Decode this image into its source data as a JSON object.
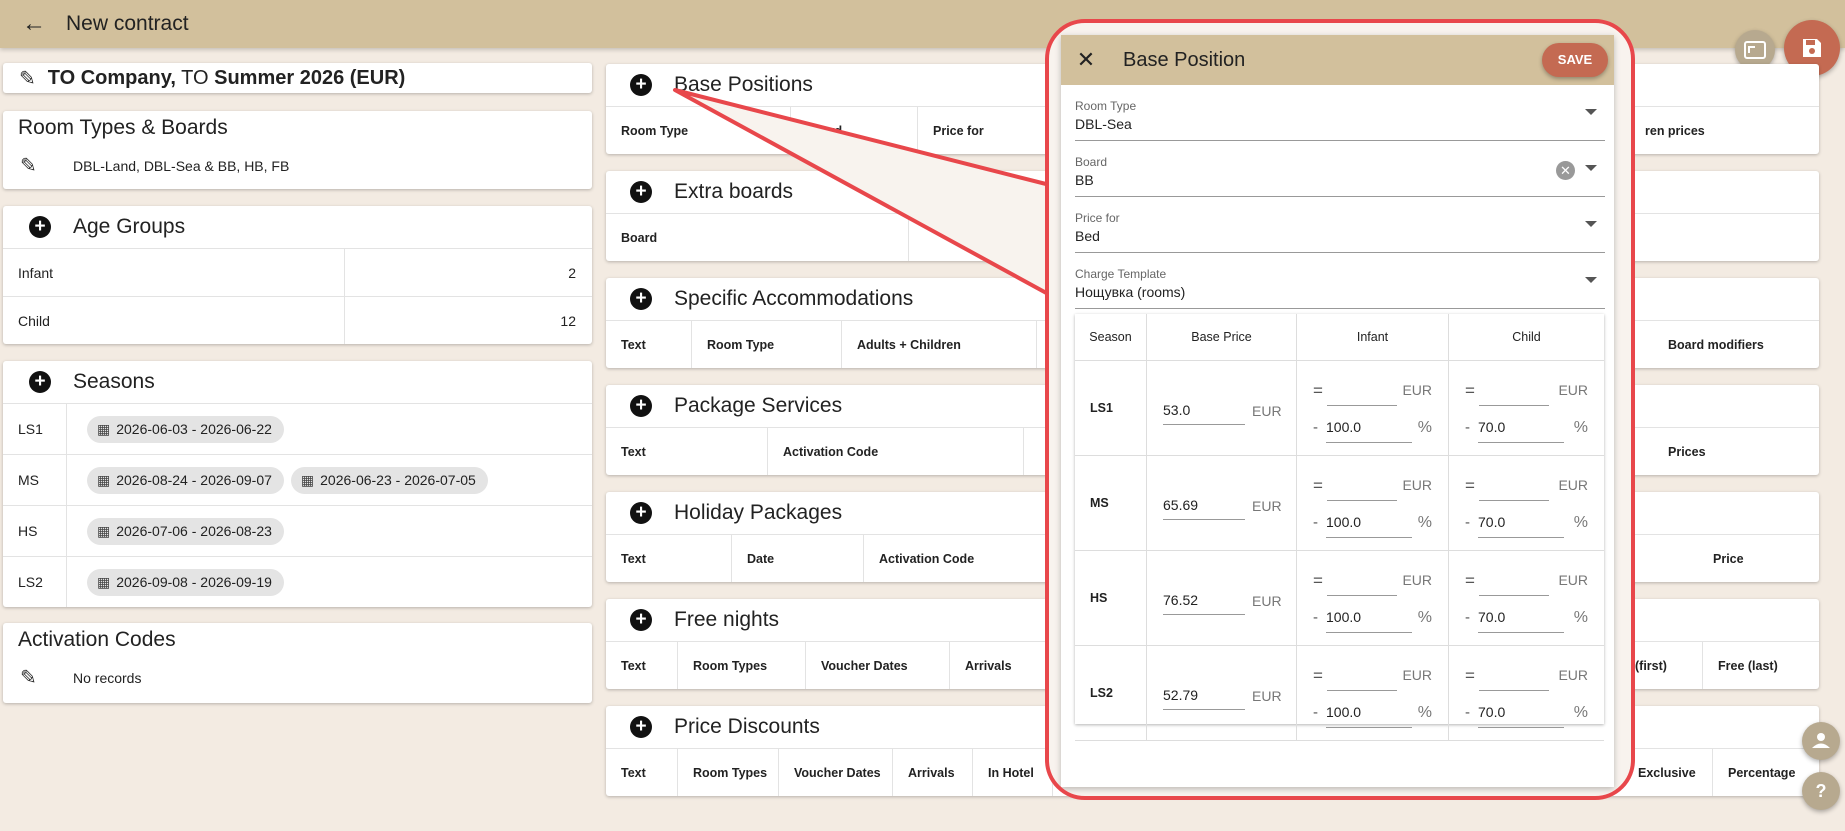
{
  "topbar": {
    "title": "New contract"
  },
  "contract": {
    "company": "TO Company,",
    "to": "TO",
    "season": "Summer 2026 (EUR)"
  },
  "room_types": {
    "title": "Room Types & Boards",
    "value": "DBL-Land, DBL-Sea & BB, HB, FB"
  },
  "age_groups": {
    "title": "Age Groups",
    "rows": [
      {
        "name": "Infant",
        "value": "2"
      },
      {
        "name": "Child",
        "value": "12"
      }
    ]
  },
  "seasons": {
    "title": "Seasons",
    "rows": [
      {
        "code": "LS1",
        "dates": [
          "2026-06-03 - 2026-06-22"
        ]
      },
      {
        "code": "MS",
        "dates": [
          "2026-08-24 - 2026-09-07",
          "2026-06-23 - 2026-07-05"
        ]
      },
      {
        "code": "HS",
        "dates": [
          "2026-07-06 - 2026-08-23"
        ]
      },
      {
        "code": "LS2",
        "dates": [
          "2026-09-08 - 2026-09-19"
        ]
      }
    ]
  },
  "activation_codes": {
    "title": "Activation Codes",
    "empty": "No records"
  },
  "right_cards": [
    {
      "title": "Base Positions",
      "cols": [
        "Room Type",
        "Board",
        "Price for"
      ],
      "right": [
        "ren prices"
      ]
    },
    {
      "title": "Extra boards",
      "cols": [
        "Board",
        ""
      ],
      "right": []
    },
    {
      "title": "Specific Accommodations",
      "cols": [
        "Text",
        "Room Type",
        "Adults + Children"
      ],
      "right": [
        "Board modifiers"
      ]
    },
    {
      "title": "Package Services",
      "cols": [
        "Text",
        "Activation Code"
      ],
      "right": [
        "Prices"
      ]
    },
    {
      "title": "Holiday Packages",
      "cols": [
        "Text",
        "Date",
        "Activation Code"
      ],
      "right": [
        "Price"
      ]
    },
    {
      "title": "Free nights",
      "cols": [
        "Text",
        "Room Types",
        "Voucher Dates",
        "Arrivals"
      ],
      "right": [
        "(first)",
        "Free (last)"
      ]
    },
    {
      "title": "Price Discounts",
      "cols": [
        "Text",
        "Room Types",
        "Voucher Dates",
        "Arrivals",
        "In Hotel"
      ],
      "right": [
        "Exclusive",
        "Percentage"
      ]
    }
  ],
  "dialog": {
    "title": "Base Position",
    "save_label": "SAVE",
    "fields": [
      {
        "label": "Room Type",
        "value": "DBL-Sea"
      },
      {
        "label": "Board",
        "value": "BB"
      },
      {
        "label": "Price for",
        "value": "Bed"
      },
      {
        "label": "Charge Template",
        "value": "Нощувка (rooms)"
      }
    ],
    "table": {
      "headers": [
        "Season",
        "Base Price",
        "Infant",
        "Child"
      ],
      "currency": "EUR",
      "eq": "=",
      "minus": "-",
      "percent": "%",
      "rows": [
        {
          "season": "LS1",
          "price": "53.0",
          "infant_pct": "100.0",
          "child_pct": "70.0"
        },
        {
          "season": "MS",
          "price": "65.69",
          "infant_pct": "100.0",
          "child_pct": "70.0"
        },
        {
          "season": "HS",
          "price": "76.52",
          "infant_pct": "100.0",
          "child_pct": "70.0"
        },
        {
          "season": "LS2",
          "price": "52.79",
          "infant_pct": "100.0",
          "child_pct": "70.0"
        }
      ]
    }
  },
  "colors": {
    "topbar": "#d2c09c",
    "save": "#c46a52",
    "fab_save": "#c46a52",
    "callout": "#e8474b",
    "background": "#f3ebe2"
  },
  "icons": [
    "back-arrow-icon",
    "pencil-icon",
    "plus-circle-icon",
    "calendar-icon",
    "close-icon",
    "fullscreen-icon",
    "save-icon",
    "help-icon",
    "guide-icon"
  ]
}
